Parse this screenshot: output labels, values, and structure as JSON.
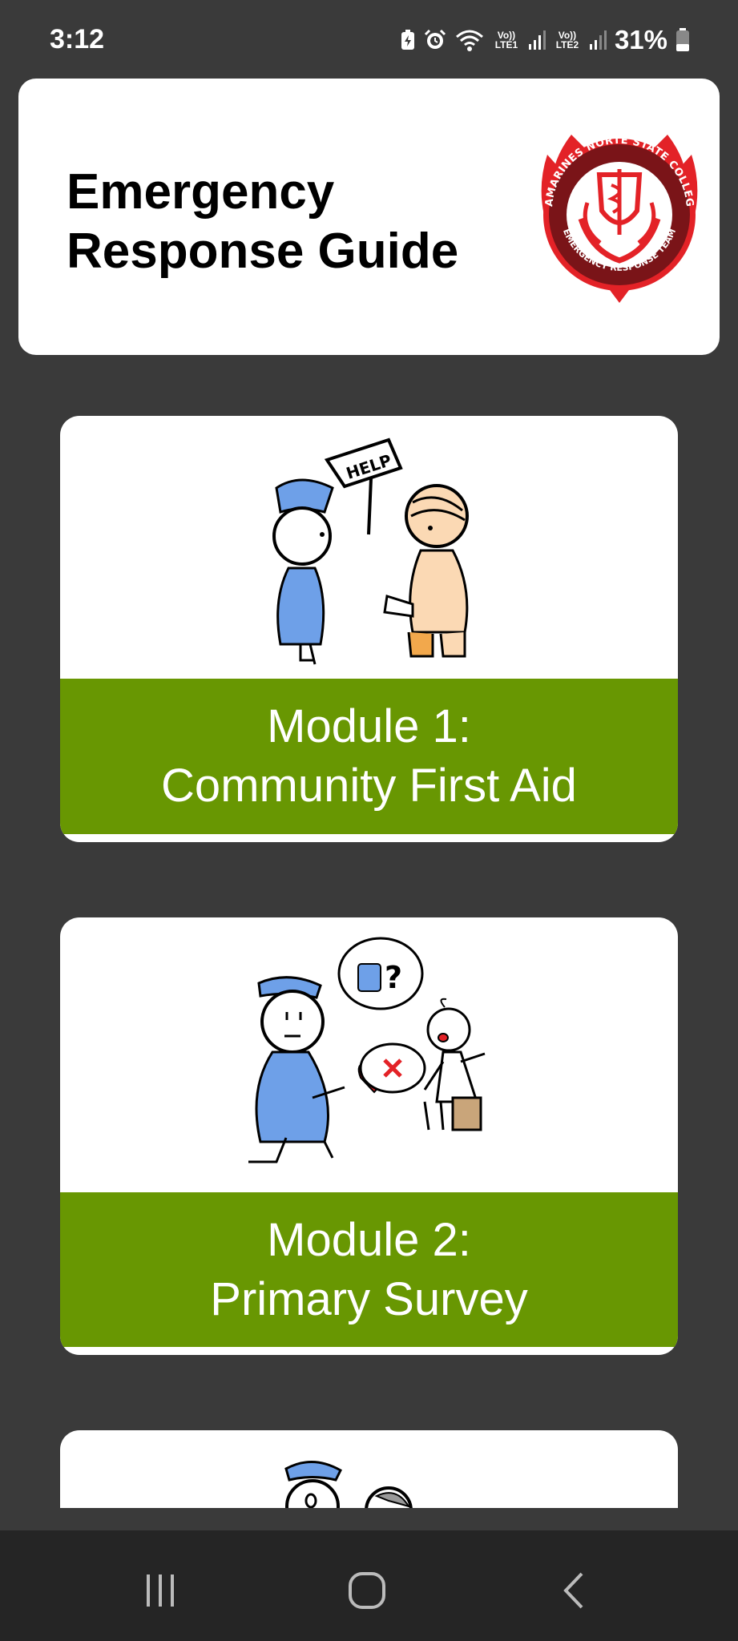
{
  "status_bar": {
    "time": "3:12",
    "battery": "31%",
    "sim1_label": "Vo)) LTE1",
    "sim2_label": "Vo)) LTE2",
    "icons": [
      "battery-saver-icon",
      "alarm-icon",
      "wifi-icon",
      "signal-icon",
      "signal-icon",
      "battery-icon"
    ]
  },
  "header": {
    "title_line1": "Emergency",
    "title_line2": "Response Guide",
    "logo": {
      "top_text": "CAMARINES NORTE STATE COLLEGE",
      "bottom_text": "EMERGENCY RESPONSE TEAM",
      "colors": {
        "red": "#e32227",
        "dark": "#7a1418"
      }
    }
  },
  "modules": [
    {
      "line1": "Module 1:",
      "line2": "Community First Aid",
      "speech": "HELP"
    },
    {
      "line1": "Module 2:",
      "line2": "Primary Survey"
    },
    {
      "line1": "",
      "line2": ""
    }
  ],
  "theme": {
    "band_color": "#689702",
    "background": "#3a3a3a"
  },
  "nav": {
    "icons": [
      "recents-icon",
      "home-icon",
      "back-icon"
    ]
  }
}
